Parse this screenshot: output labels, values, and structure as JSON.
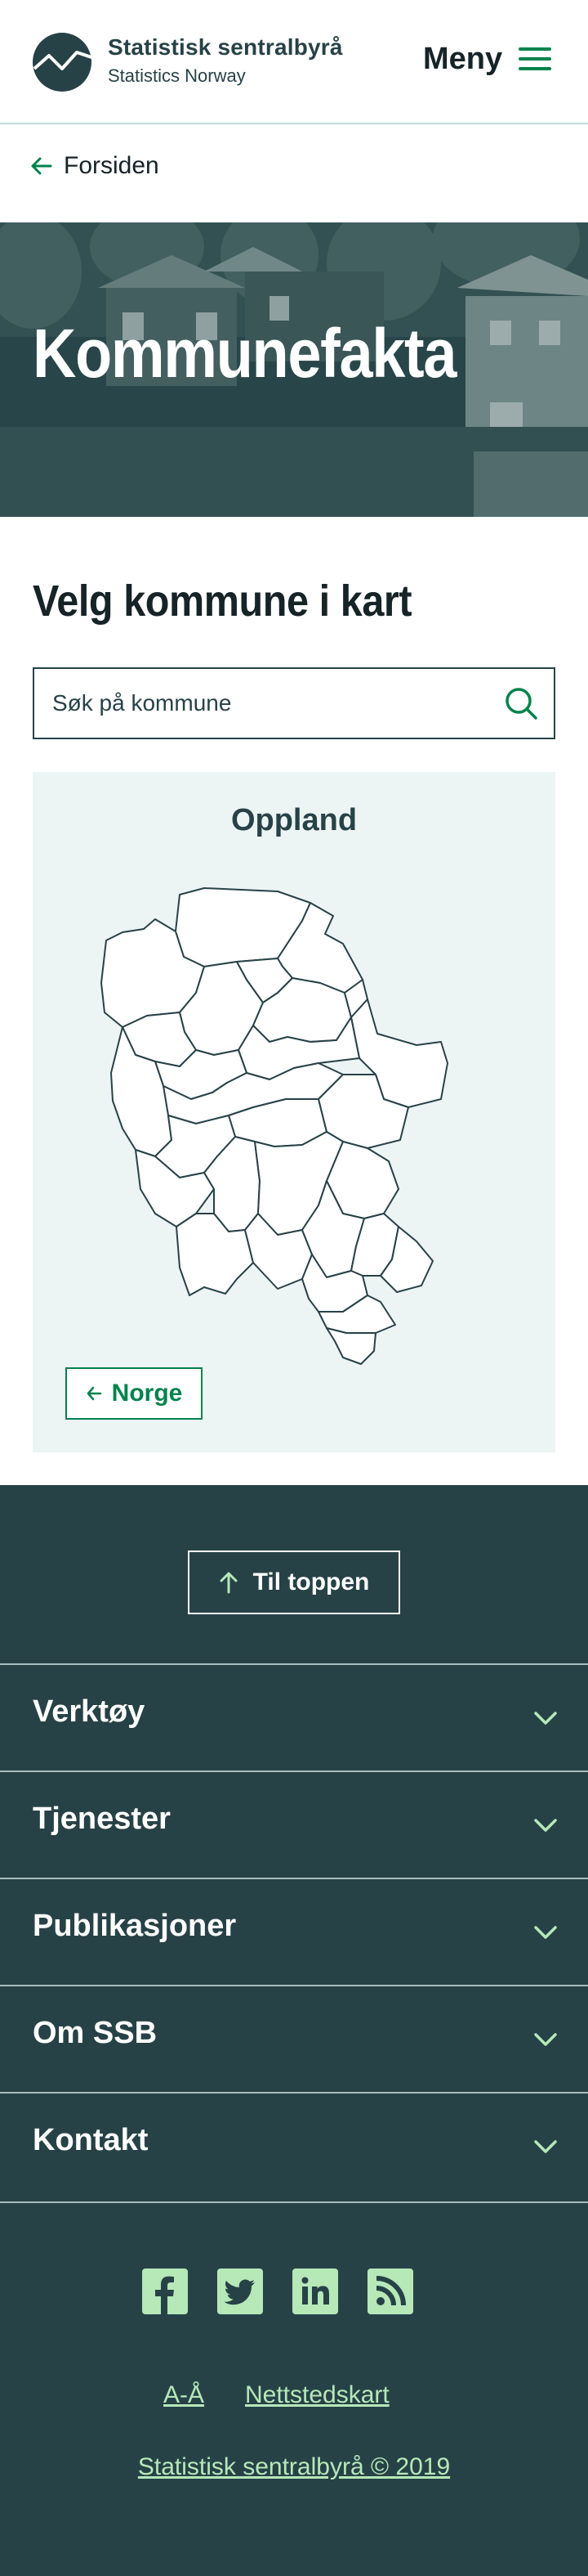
{
  "header": {
    "brand_name": "Statistisk sentralbyrå",
    "brand_subtitle": "Statistics Norway",
    "menu_label": "Meny"
  },
  "breadcrumb": {
    "label": "Forsiden"
  },
  "hero": {
    "title": "Kommunefakta"
  },
  "map_section": {
    "title": "Velg kommune i kart",
    "search_placeholder": "Søk på kommune",
    "map_title": "Oppland",
    "back_button_label": "Norge"
  },
  "footer": {
    "to_top_label": "Til toppen",
    "accordion": [
      {
        "label": "Verktøy"
      },
      {
        "label": "Tjenester"
      },
      {
        "label": "Publikasjoner"
      },
      {
        "label": "Om SSB"
      },
      {
        "label": "Kontakt"
      }
    ],
    "social": [
      "facebook-icon",
      "twitter-icon",
      "linkedin-icon",
      "rss-icon"
    ],
    "links": [
      {
        "label": "A-Å"
      },
      {
        "label": "Nettstedskart"
      }
    ],
    "copyright": "Statistisk sentralbyrå © 2019"
  },
  "colors": {
    "accent_green": "#00824d",
    "dark_teal": "#274247",
    "light_green": "#b6e8b8",
    "map_bg": "#ecf4f4"
  }
}
